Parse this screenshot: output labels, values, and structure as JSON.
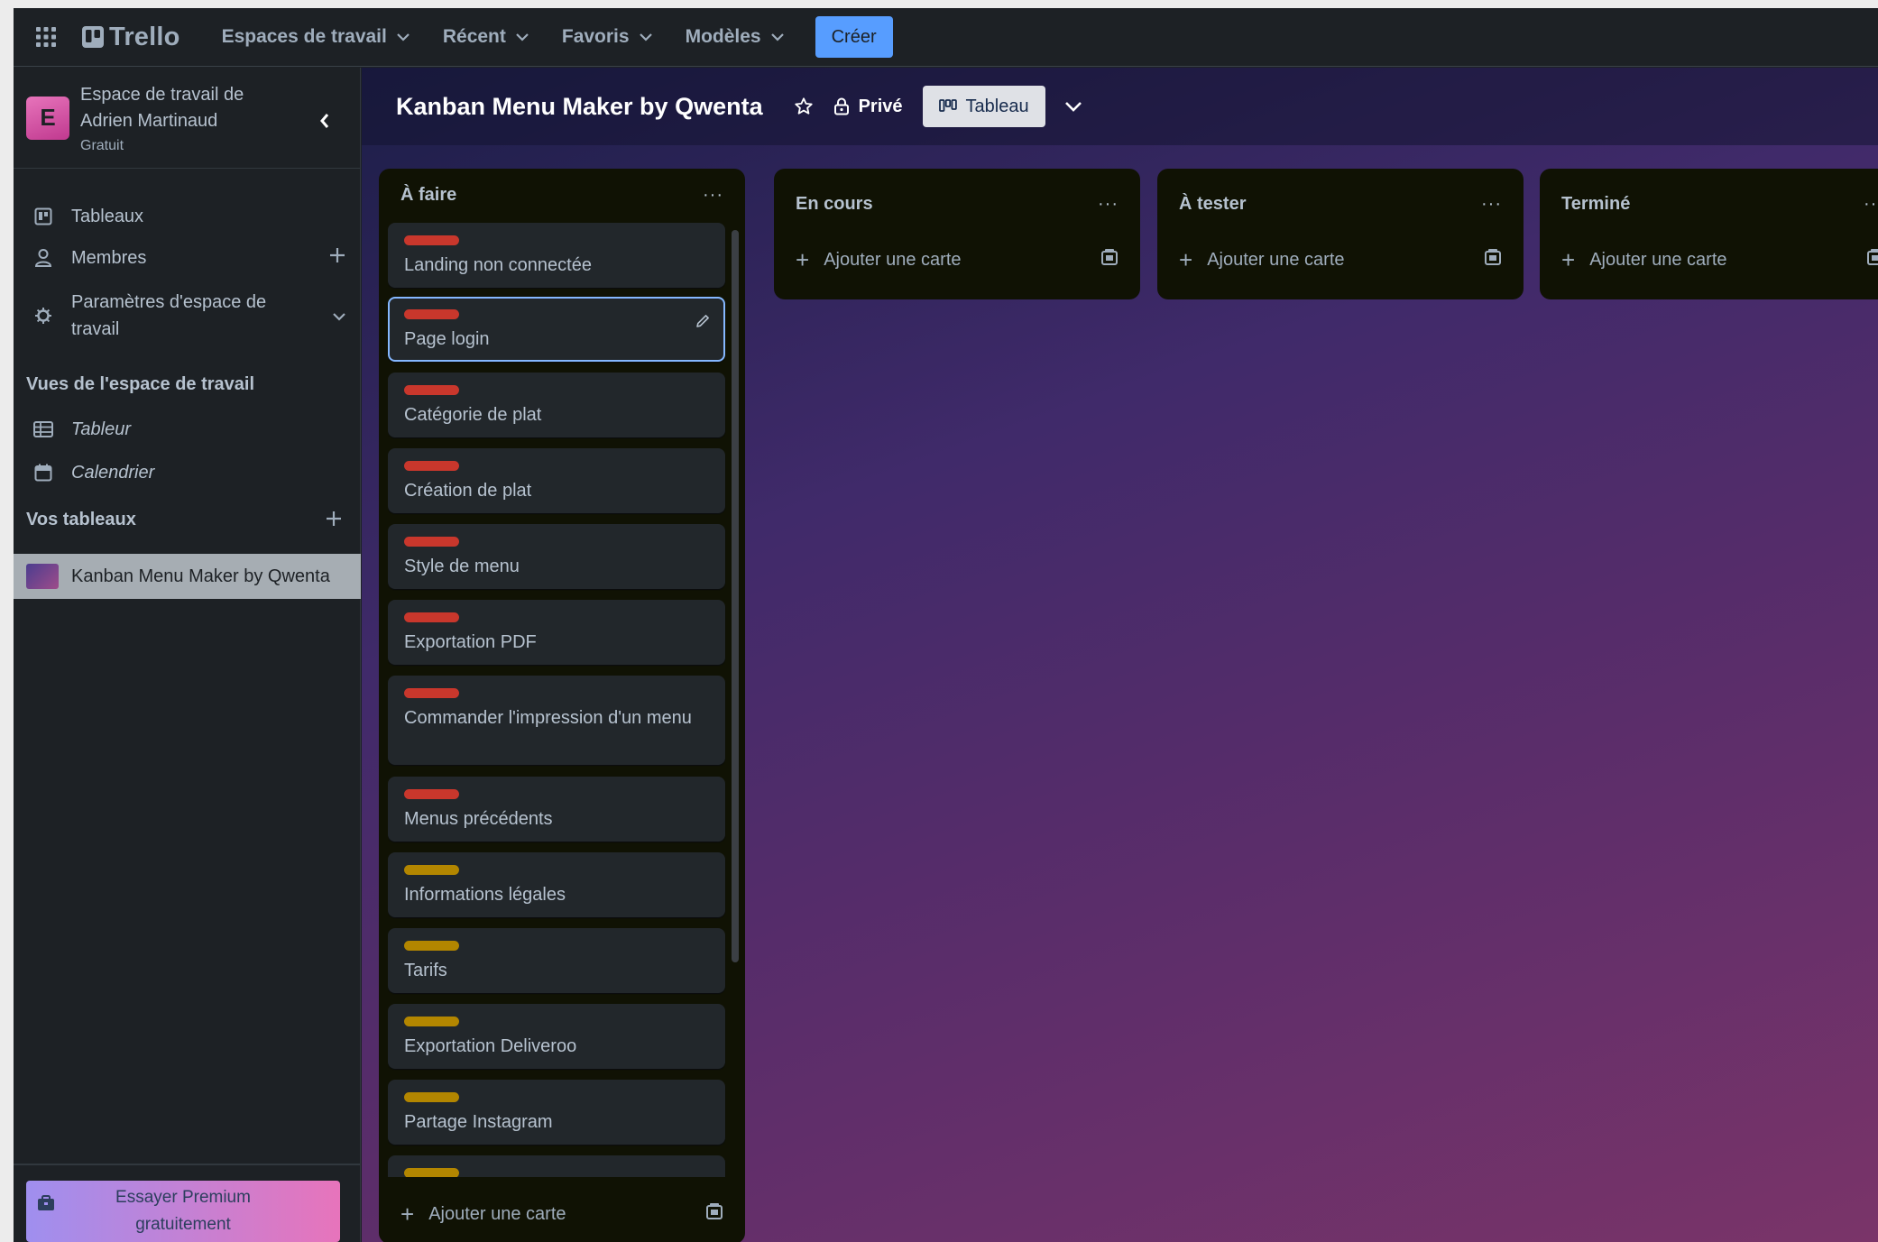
{
  "topbar": {
    "logo": "Trello",
    "nav": [
      "Espaces de travail",
      "Récent",
      "Favoris",
      "Modèles"
    ],
    "create": "Créer"
  },
  "workspace": {
    "initial": "E",
    "name": "Espace de travail de Adrien Martinaud",
    "plan": "Gratuit"
  },
  "sidebar": {
    "items": [
      {
        "label": "Tableaux"
      },
      {
        "label": "Membres"
      },
      {
        "label": "Paramètres d'espace de travail"
      }
    ],
    "views_title": "Vues de l'espace de travail",
    "views": [
      {
        "label": "Tableur"
      },
      {
        "label": "Calendrier"
      }
    ],
    "boards_title": "Vos tableaux",
    "boards": [
      {
        "label": "Kanban Menu Maker by Qwenta"
      }
    ],
    "premium": "Essayer Premium gratuitement"
  },
  "board": {
    "title": "Kanban Menu Maker by Qwenta",
    "visibility": "Privé",
    "view": "Tableau"
  },
  "colors": {
    "label_red": "#c9372c",
    "label_yellow": "#b38600"
  },
  "lists": [
    {
      "title": "À faire",
      "menu": "···",
      "add_card": "Ajouter une carte",
      "cards": [
        {
          "title": "Landing non connectée",
          "label": "red"
        },
        {
          "title": "Page login",
          "label": "red"
        },
        {
          "title": "Catégorie de plat",
          "label": "red"
        },
        {
          "title": "Création de plat",
          "label": "red"
        },
        {
          "title": "Style de menu",
          "label": "red"
        },
        {
          "title": "Exportation PDF",
          "label": "red"
        },
        {
          "title": "Commander l'impression d'un menu",
          "label": "red"
        },
        {
          "title": "Menus précédents",
          "label": "red"
        },
        {
          "title": "Informations légales",
          "label": "yellow"
        },
        {
          "title": "Tarifs",
          "label": "yellow"
        },
        {
          "title": "Exportation Deliveroo",
          "label": "yellow"
        },
        {
          "title": "Partage Instagram",
          "label": "yellow"
        }
      ]
    },
    {
      "title": "En cours",
      "menu": "···",
      "add_card": "Ajouter une carte"
    },
    {
      "title": "À tester",
      "menu": "···",
      "add_card": "Ajouter une carte"
    },
    {
      "title": "Terminé",
      "menu": "···",
      "add_card": "Ajouter une carte"
    }
  ]
}
